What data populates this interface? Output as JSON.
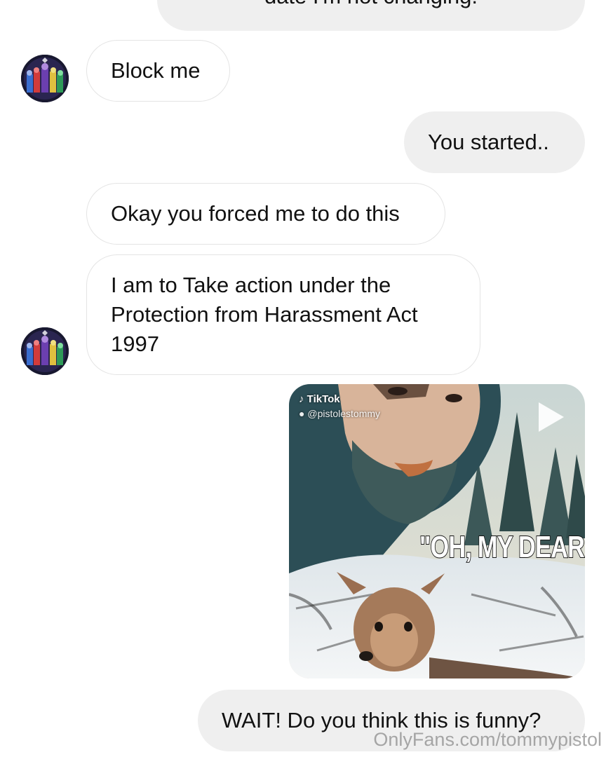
{
  "messages": [
    {
      "from": "me",
      "text": "date I'm not changing."
    },
    {
      "from": "them",
      "text": "Block me"
    },
    {
      "from": "me",
      "text": "You started.."
    },
    {
      "from": "them",
      "text": "Okay you forced me to do this"
    },
    {
      "from": "them",
      "text": "I am to Take action under the Protection from Harassment Act 1997"
    },
    {
      "from": "me",
      "text": "WAIT! Do you think this is funny?"
    }
  ],
  "media": {
    "platform": "TikTok",
    "handle": "@pistolestommy",
    "caption": "\"OH, MY DEAR.",
    "play_icon": "play-icon"
  },
  "watermark": "OnlyFans.com/tommypistol",
  "colors": {
    "background": "#ffffff",
    "sent_bubble": "#efefef",
    "received_border": "#e4e4e4",
    "text": "#111111"
  }
}
